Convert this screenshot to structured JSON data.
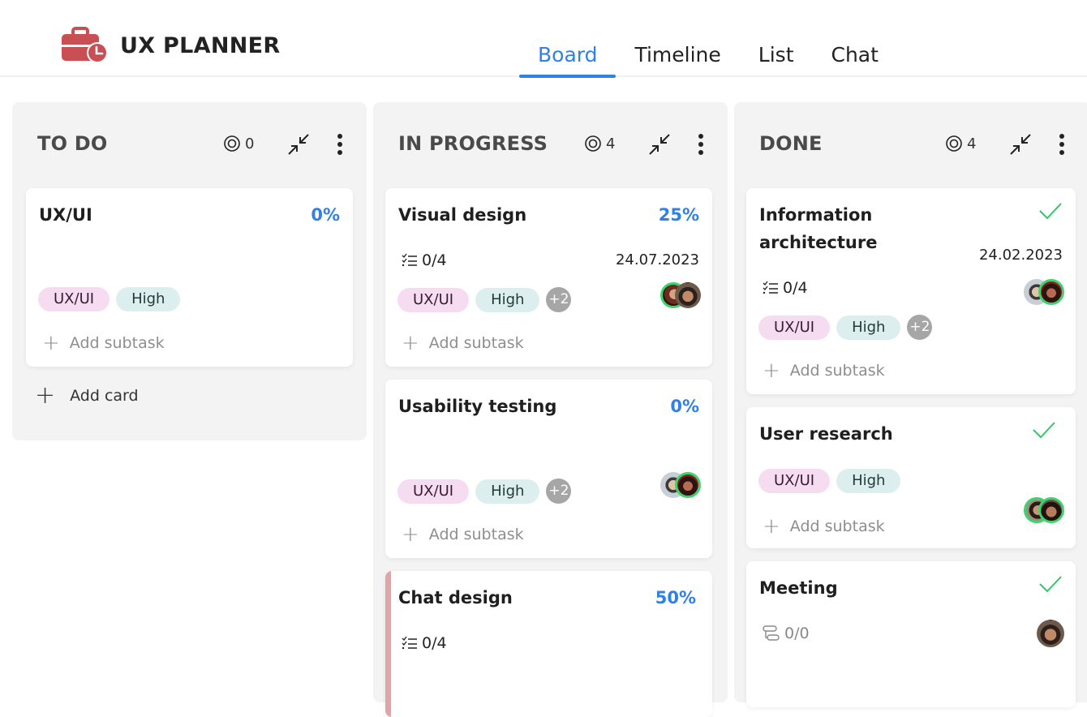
{
  "app": {
    "title": "UX PLANNER",
    "brand_color": "#c85054",
    "accent_color": "#2f80e8"
  },
  "tabs": [
    {
      "label": "Board",
      "active": true
    },
    {
      "label": "Timeline",
      "active": false
    },
    {
      "label": "List",
      "active": false
    },
    {
      "label": "Chat",
      "active": false
    }
  ],
  "columns": [
    {
      "title": "TO DO",
      "count": "0",
      "add_card_label": "Add card",
      "cards": [
        {
          "title": "UX/UI",
          "progress": "0%",
          "tags": [
            "UX/UI",
            "High"
          ],
          "add_subtask_label": "Add subtask"
        }
      ]
    },
    {
      "title": "IN PROGRESS",
      "count": "4",
      "cards": [
        {
          "title": "Visual design",
          "progress": "25%",
          "subtasks": "0/4",
          "date": "24.07.2023",
          "tags": [
            "UX/UI",
            "High"
          ],
          "more_tags": "+2",
          "avatars": [
            "avatar-woman",
            "avatar-man"
          ],
          "add_subtask_label": "Add subtask"
        },
        {
          "title": "Usability testing",
          "progress": "0%",
          "tags": [
            "UX/UI",
            "High"
          ],
          "more_tags": "+2",
          "avatars": [
            "avatar-man-glasses",
            "avatar-woman"
          ],
          "add_subtask_label": "Add subtask"
        },
        {
          "title": "Chat design",
          "progress": "50%",
          "subtasks": "0/4"
        }
      ]
    },
    {
      "title": "DONE",
      "count": "4",
      "cards": [
        {
          "title": "Information architecture",
          "title_line1": "Information",
          "title_line2": "architecture",
          "status": "done",
          "date": "24.02.2023",
          "subtasks": "0/4",
          "tags": [
            "UX/UI",
            "High"
          ],
          "more_tags": "+2",
          "avatars": [
            "avatar-man-glasses",
            "avatar-woman"
          ],
          "add_subtask_label": "Add subtask"
        },
        {
          "title": "User research",
          "status": "done",
          "tags": [
            "UX/UI",
            "High"
          ],
          "avatars": [
            "avatar-man",
            "avatar-man-smiling"
          ],
          "add_subtask_label": "Add subtask"
        },
        {
          "title": "Meeting",
          "status": "done",
          "subtasks": "0/0",
          "avatars": [
            "avatar-man"
          ]
        }
      ]
    }
  ]
}
